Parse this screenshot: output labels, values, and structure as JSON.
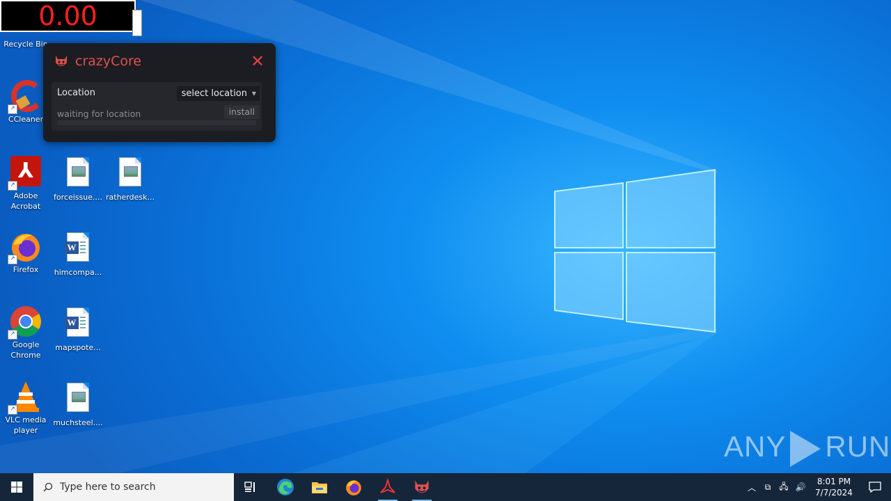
{
  "counter": {
    "value": "0.00"
  },
  "desktop_icons": [
    {
      "label": "Recycle Bin"
    },
    {
      "label": "CCleaner"
    },
    {
      "label": "Adobe Acrobat"
    },
    {
      "label": "forceissue...."
    },
    {
      "label": "ratherdesk..."
    },
    {
      "label": "Firefox"
    },
    {
      "label": "himcompa..."
    },
    {
      "label": "Google Chrome"
    },
    {
      "label": "mapspote..."
    },
    {
      "label": "VLC media player"
    },
    {
      "label": "muchsteel...."
    }
  ],
  "app_window": {
    "title": "crazyCore",
    "location_label": "Location",
    "location_select": "select location",
    "status": "waiting for location",
    "install_label": "install",
    "progress": 0,
    "accent_color": "#e05050"
  },
  "watermark": {
    "left": "ANY",
    "right": "RUN"
  },
  "taskbar": {
    "search_placeholder": "Type here to search",
    "apps": [
      "task-view",
      "edge",
      "file-explorer",
      "firefox",
      "acrobat",
      "crazycore"
    ],
    "time": "8:01 PM",
    "date": "7/7/2024"
  }
}
